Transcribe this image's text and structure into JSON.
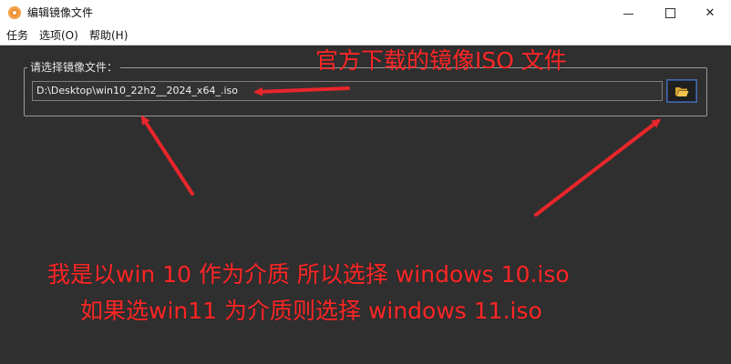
{
  "window": {
    "title": "编辑镜像文件",
    "controls": {
      "minimize_icon": "minimize-icon",
      "maximize_icon": "maximize-icon",
      "close_glyph": "✕"
    }
  },
  "menubar": {
    "items": [
      {
        "label": "任务"
      },
      {
        "label": "选项(O)"
      },
      {
        "label": "帮助(H)"
      }
    ]
  },
  "image_select": {
    "group_label": "请选择镜像文件：",
    "path_value": "D:\\Desktop\\win10_22h2__2024_x64_.iso",
    "browse_icon": "folder-open-icon"
  },
  "annotations": {
    "top_note": "官方下载的镜像ISO 文件",
    "line1": "我是以win 10  作为介质 所以选择 windows 10.iso",
    "line2": "如果选win11 为介质则选择 windows 11.iso",
    "color": "#ff2626"
  },
  "colors": {
    "background": "#2f2f2f",
    "titlebar": "#ffffff",
    "accent_border": "#4a6aa8",
    "folder": "#f2c14e"
  }
}
